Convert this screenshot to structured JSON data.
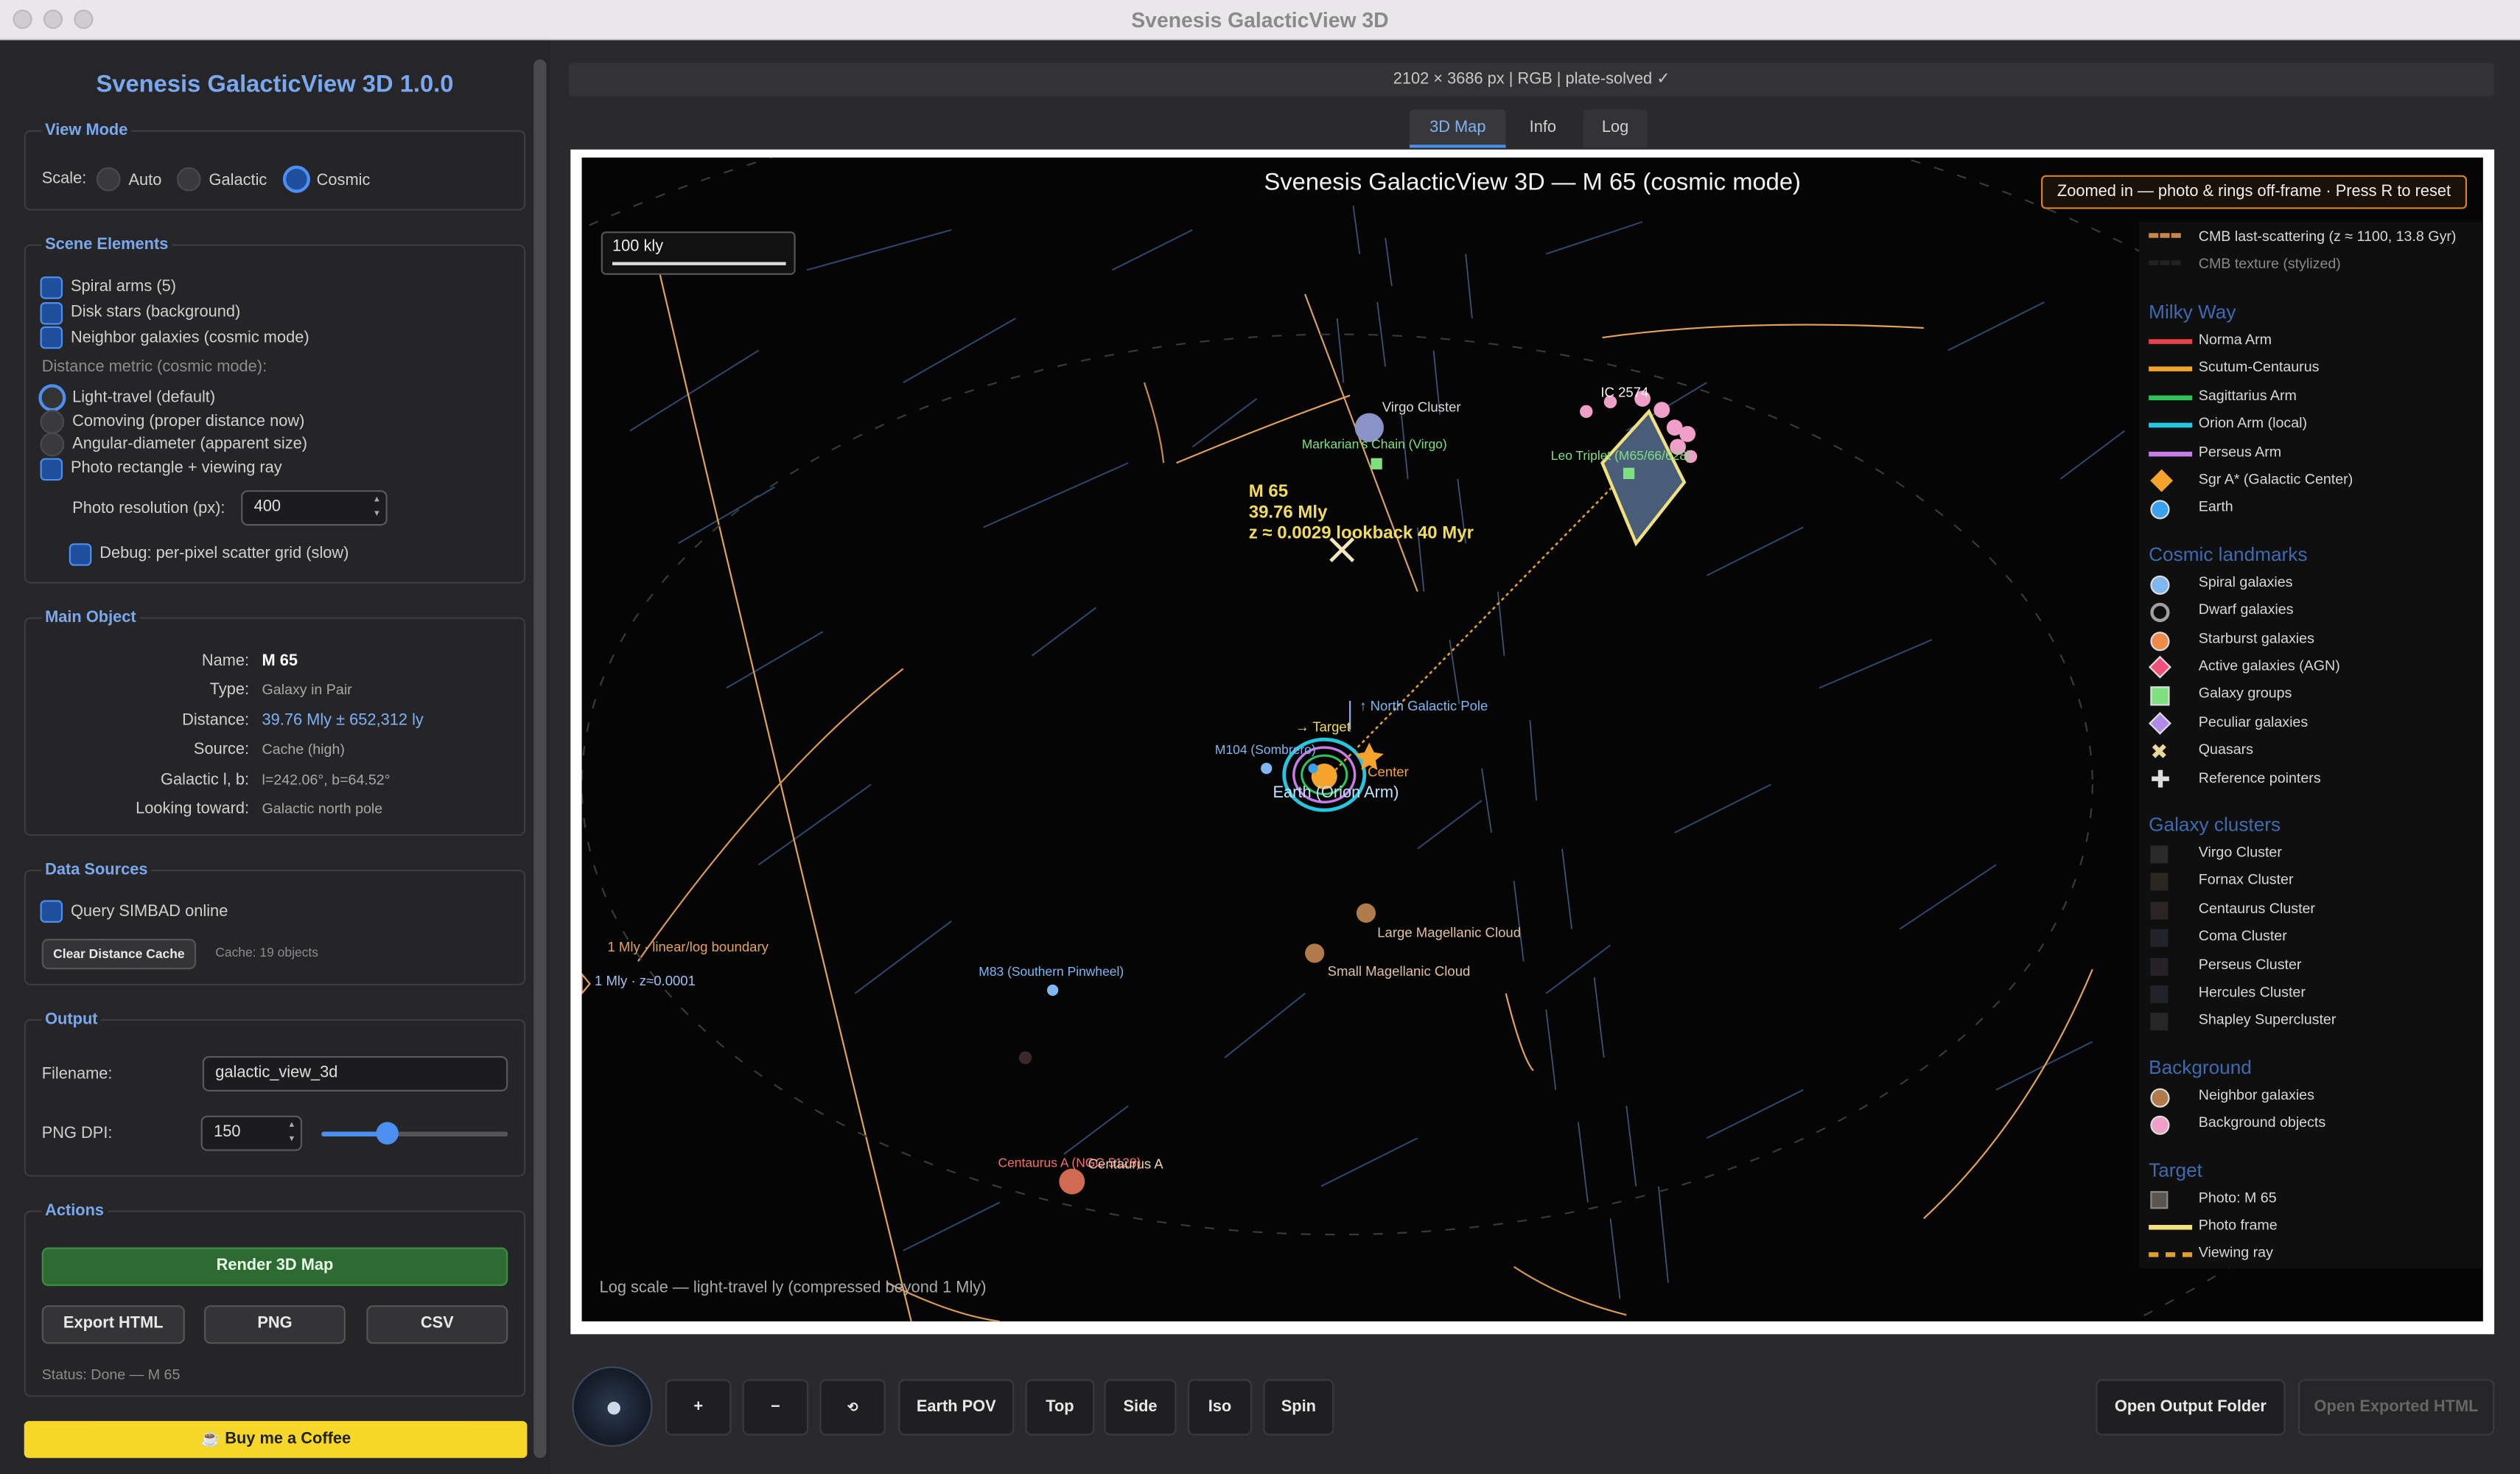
{
  "window": {
    "title": "Svenesis GalacticView 3D"
  },
  "sidebar": {
    "app_title": "Svenesis GalacticView 3D 1.0.0",
    "view_mode": {
      "title": "View Mode",
      "scale_label": "Scale:",
      "options": [
        "Auto",
        "Galactic",
        "Cosmic"
      ],
      "selected": "Cosmic"
    },
    "scene": {
      "title": "Scene Elements",
      "spiral_arms": "Spiral arms (5)",
      "disk_stars": "Disk stars (background)",
      "neighbor_galaxies": "Neighbor galaxies (cosmic mode)",
      "distance_metric_label": "Distance metric (cosmic mode):",
      "metric_options": [
        "Light-travel (default)",
        "Comoving (proper distance now)",
        "Angular-diameter (apparent size)"
      ],
      "photo_rect": "Photo rectangle + viewing ray",
      "photo_res_label": "Photo resolution (px):",
      "photo_res_value": "400",
      "debug": "Debug: per-pixel scatter grid (slow)"
    },
    "main_object": {
      "title": "Main Object",
      "rows": [
        {
          "k": "Name:",
          "v": "M  65"
        },
        {
          "k": "Type:",
          "v": "Galaxy in Pair"
        },
        {
          "k": "Distance:",
          "v": "39.76 Mly ± 652,312 ly"
        },
        {
          "k": "Source:",
          "v": "Cache (high)"
        },
        {
          "k": "Galactic l, b:",
          "v": "l=242.06°, b=64.52°"
        },
        {
          "k": "Looking toward:",
          "v": "Galactic north pole"
        }
      ]
    },
    "data_sources": {
      "title": "Data Sources",
      "query_simbad": "Query SIMBAD online",
      "clear_cache": "Clear Distance Cache",
      "cache_info": "Cache: 19 objects"
    },
    "output": {
      "title": "Output",
      "filename_label": "Filename:",
      "filename_value": "galactic_view_3d",
      "dpi_label": "PNG DPI:",
      "dpi_value": "150",
      "dpi_slider_fraction": 0.35
    },
    "actions": {
      "title": "Actions",
      "render": "Render 3D Map",
      "export_html": "Export HTML",
      "png": "PNG",
      "csv": "CSV",
      "status": "Status: Done — M  65"
    },
    "coffee": "☕ Buy me a Coffee"
  },
  "main": {
    "info_bar": "2102 × 3686 px  |  RGB  |  plate-solved ✓",
    "tabs": [
      "3D Map",
      "Info",
      "Log"
    ],
    "active_tab": "3D Map",
    "canvas": {
      "title": "Svenesis GalacticView 3D — M  65 (cosmic mode)",
      "zoom_note": "Zoomed in — photo & rings off-frame · Press R to reset",
      "scale_label": "100 kly",
      "footer": "Log scale — light-travel ly (compressed beyond 1 Mly)",
      "target_label": [
        "M  65",
        "39.76 Mly",
        "z ≈ 0.0029   lookback 40 Myr"
      ],
      "labels": {
        "virgo": "Virgo Cluster",
        "markarian": "Markarian's Chain (Virgo)",
        "ic2574": "IC 2574",
        "leo_triplet": "Leo Triplet (M65/66/628)",
        "north_pole": "↑ North Galactic Pole",
        "target_arrow": "→ Target",
        "m104": "M104 (Sombrero)",
        "center": "Center",
        "earth": "Earth (Orion Arm)",
        "lmc": "Large Magellanic Cloud",
        "smc": "Small Magellanic Cloud",
        "m83": "M83 (Southern Pinwheel)",
        "centaurus": "Centaurus A (NGC 5128)",
        "centaurus2": "Centaurus A",
        "boundary": "1 Mly · linear/log boundary",
        "ring": "1 Mly · z≈0.0001"
      }
    },
    "legend": {
      "top": [
        {
          "label": "CMB last-scattering (z ≈ 1100, 13.8 Gyr)",
          "color": "#c8874a"
        },
        {
          "label": "CMB texture (stylized)",
          "color": "#222"
        }
      ],
      "sections": [
        {
          "title": "Milky Way",
          "items": [
            {
              "label": "Norma Arm",
              "color": "#e8424a"
            },
            {
              "label": "Scutum-Centaurus",
              "color": "#f4a32c"
            },
            {
              "label": "Sagittarius Arm",
              "color": "#2fc45a"
            },
            {
              "label": "Orion Arm (local)",
              "color": "#27c6e0"
            },
            {
              "label": "Perseus Arm",
              "color": "#c77de8"
            },
            {
              "label": "Sgr A* (Galactic Center)",
              "color": "#f4a32c"
            },
            {
              "label": "Earth",
              "color": "#3aa0f0"
            }
          ]
        },
        {
          "title": "Cosmic landmarks",
          "items": [
            {
              "label": "Spiral galaxies",
              "color": "#7fb7f0"
            },
            {
              "label": "Dwarf galaxies",
              "color": "#a0a0a0"
            },
            {
              "label": "Starburst galaxies",
              "color": "#f08a4a"
            },
            {
              "label": "Active galaxies (AGN)",
              "color": "#f0507a"
            },
            {
              "label": "Galaxy groups",
              "color": "#7ee07e"
            },
            {
              "label": "Peculiar galaxies",
              "color": "#b08ae8"
            },
            {
              "label": "Quasars",
              "color": "#e8d8a0"
            },
            {
              "label": "Reference pointers",
              "color": "#dddddd"
            }
          ]
        },
        {
          "title": "Galaxy clusters",
          "items": [
            {
              "label": "Virgo Cluster",
              "color": "#2a2a2a"
            },
            {
              "label": "Fornax Cluster",
              "color": "#2a2620"
            },
            {
              "label": "Centaurus Cluster",
              "color": "#2a2424"
            },
            {
              "label": "Coma Cluster",
              "color": "#22242a"
            },
            {
              "label": "Perseus Cluster",
              "color": "#262228"
            },
            {
              "label": "Hercules Cluster",
              "color": "#22222a"
            },
            {
              "label": "Shapley Supercluster",
              "color": "#262626"
            }
          ]
        },
        {
          "title": "Background",
          "items": [
            {
              "label": "Neighbor galaxies",
              "color": "#b07a4a"
            },
            {
              "label": "Background objects",
              "color": "#f0a0c8"
            }
          ]
        },
        {
          "title": "Target",
          "items": [
            {
              "label": "Photo: M  65",
              "color": "#5a5450"
            },
            {
              "label": "Photo frame",
              "color": "#f0e080"
            },
            {
              "label": "Viewing ray",
              "color": "#e0a030"
            }
          ]
        }
      ]
    },
    "controls": {
      "buttons": [
        "+",
        "−",
        "⟲",
        "Earth POV",
        "Top",
        "Side",
        "Iso",
        "Spin"
      ],
      "open_folder": "Open Output Folder",
      "open_html": "Open Exported HTML"
    }
  }
}
